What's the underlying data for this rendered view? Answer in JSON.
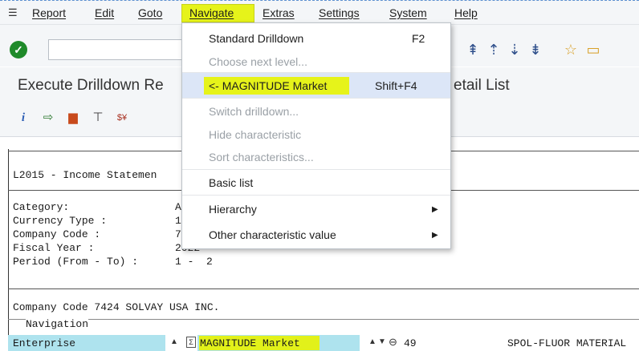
{
  "menubar": {
    "items": [
      "Report",
      "Edit",
      "Goto",
      "Navigate",
      "Extras",
      "Settings",
      "System",
      "Help"
    ]
  },
  "title": {
    "left": "Execute Drilldown Re",
    "right": "etail List"
  },
  "report": {
    "header": "L2015 - Income Statemen",
    "labels": {
      "category": "Category:",
      "currency": "Currency Type :",
      "company": "Company Code :",
      "fiscal": "Fiscal Year :",
      "period": "Period (From - To) :"
    },
    "values": {
      "category": "A",
      "currency": "1",
      "company": "7",
      "fiscal": "2022",
      "period": "1 -  2"
    },
    "company_line": "Company Code 7424 SOLVAY USA INC.",
    "navigation_label": "Navigation",
    "nav_row": {
      "enterprise": "Enterprise",
      "characteristic": "MAGNITUDE Market",
      "count": "49",
      "right_text": "SPOL-FLUOR MATERIAL"
    }
  },
  "dropdown": {
    "items": [
      {
        "label": "Standard Drilldown",
        "shortcut": "F2",
        "disabled": false
      },
      {
        "label": "Choose next level...",
        "shortcut": "",
        "disabled": true
      },
      {
        "label": "<- MAGNITUDE Market",
        "shortcut": "Shift+F4",
        "disabled": false
      },
      {
        "label": "Switch drilldown...",
        "shortcut": "",
        "disabled": true
      },
      {
        "label": "Hide characteristic",
        "shortcut": "",
        "disabled": true
      },
      {
        "label": "Sort characteristics...",
        "shortcut": "",
        "disabled": true
      },
      {
        "label": "Basic list",
        "shortcut": "",
        "disabled": false
      },
      {
        "label": "Hierarchy",
        "shortcut": "",
        "disabled": false
      },
      {
        "label": "Other characteristic value",
        "shortcut": "",
        "disabled": false
      }
    ]
  },
  "colors": {
    "highlight": "#e6f31a",
    "selected_row": "#dce6f7",
    "cell_blue": "#aee3ee",
    "enter_green": "#1f8a2a"
  }
}
